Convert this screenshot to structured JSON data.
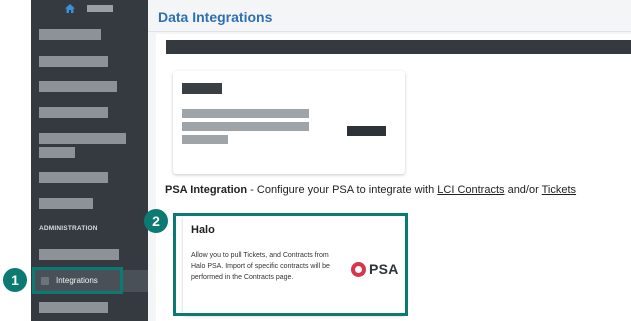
{
  "main": {
    "title": "Data Integrations",
    "psa_section": {
      "label": "PSA Integration",
      "text": " - Configure your PSA to integrate with ",
      "link1": "LCI Contracts",
      "between": " and/or ",
      "link2": "Tickets"
    },
    "halo_card": {
      "title": "Halo",
      "description": "Allow you to pull Tickets, and Contracts from Halo PSA. Import of specific contracts will be performed in the Contracts page.",
      "logo_text": "PSA"
    }
  },
  "sidebar": {
    "section_label": "ADMINISTRATION",
    "active_item": "Integrations"
  },
  "annotations": {
    "step1": "1",
    "step2": "2"
  },
  "colors": {
    "sidebar_bg": "#343a40",
    "accent_teal": "#0b7a72",
    "title_blue": "#2f6fb4",
    "psa_logo_red": "#d9344a"
  },
  "icons": [
    "home-icon",
    "integrations-icon",
    "psa-logo-icon"
  ]
}
